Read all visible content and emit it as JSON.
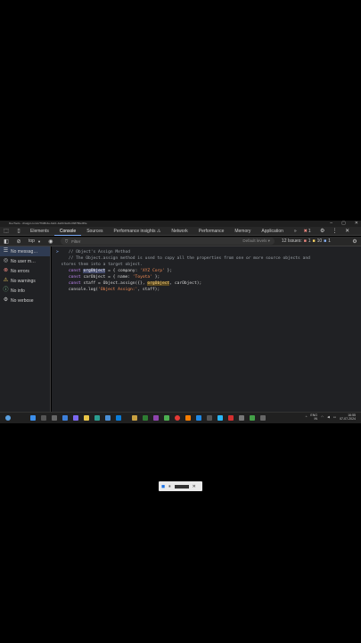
{
  "window": {
    "title": "DevTools - chatgpt.com/c/7638c4e-9eb1-4a00-9a19-0b8780e0f0e"
  },
  "devtools_tabs": [
    {
      "label": "Elements",
      "active": false
    },
    {
      "label": "Console",
      "active": true
    },
    {
      "label": "Sources",
      "active": false
    },
    {
      "label": "Performance insights ⚠",
      "active": false
    },
    {
      "label": "Network",
      "active": false
    },
    {
      "label": "Performance",
      "active": false
    },
    {
      "label": "Memory",
      "active": false
    },
    {
      "label": "Application",
      "active": false
    }
  ],
  "tab_more": "»",
  "error_badge": "1",
  "toolbar": {
    "context": "top",
    "filter_placeholder": "Filter",
    "levels": "Default levels ▾",
    "issues": "12 Issues:",
    "issues_errors": "1",
    "issues_warnings": "10",
    "issues_info": "1"
  },
  "sidebar": [
    {
      "label": "No messag…",
      "icon": "list-icon",
      "color": "#c8c8c8"
    },
    {
      "label": "No user m…",
      "icon": "user-icon",
      "color": "#c8c8c8"
    },
    {
      "label": "No errors",
      "icon": "error-icon",
      "color": "#f28b82"
    },
    {
      "label": "No warnings",
      "icon": "warning-icon",
      "color": "#fdd663"
    },
    {
      "label": "No info",
      "icon": "info-icon",
      "color": "#81c995"
    },
    {
      "label": "No verbose",
      "icon": "verbose-icon",
      "color": "#c8c8c8"
    }
  ],
  "console": {
    "prompt": ">",
    "l1": "// Object's Assign Method",
    "l2": "// The Object.assign method is used to copy all the properties from one or more source objects and",
    "l3": "stores them into a target object.",
    "l4_kw": "const",
    "l4_hl": "orgObject",
    "l4_rest": " = { company: ",
    "l4_str": "'XYZ Corp'",
    "l4_end": " };",
    "l5_kw": "const",
    "l5_rest": " carObject = { name: ",
    "l5_str": "'Toyota'",
    "l5_end": " };",
    "l6_kw": "const",
    "l6_rest": " staff = Object.assign({}, ",
    "l6_hl": "orgObject",
    "l6_end": ", carObject);",
    "l7_a": "console.log(",
    "l7_str": "'Object Assign:'",
    "l7_b": ", staff);"
  },
  "taskbar": {
    "lang": "ENG\nIN",
    "time": "16:55",
    "date": "07-07-2024"
  },
  "colors": {
    "accent": "#7cacf8",
    "error": "#f28b82",
    "warning": "#fdd663"
  }
}
